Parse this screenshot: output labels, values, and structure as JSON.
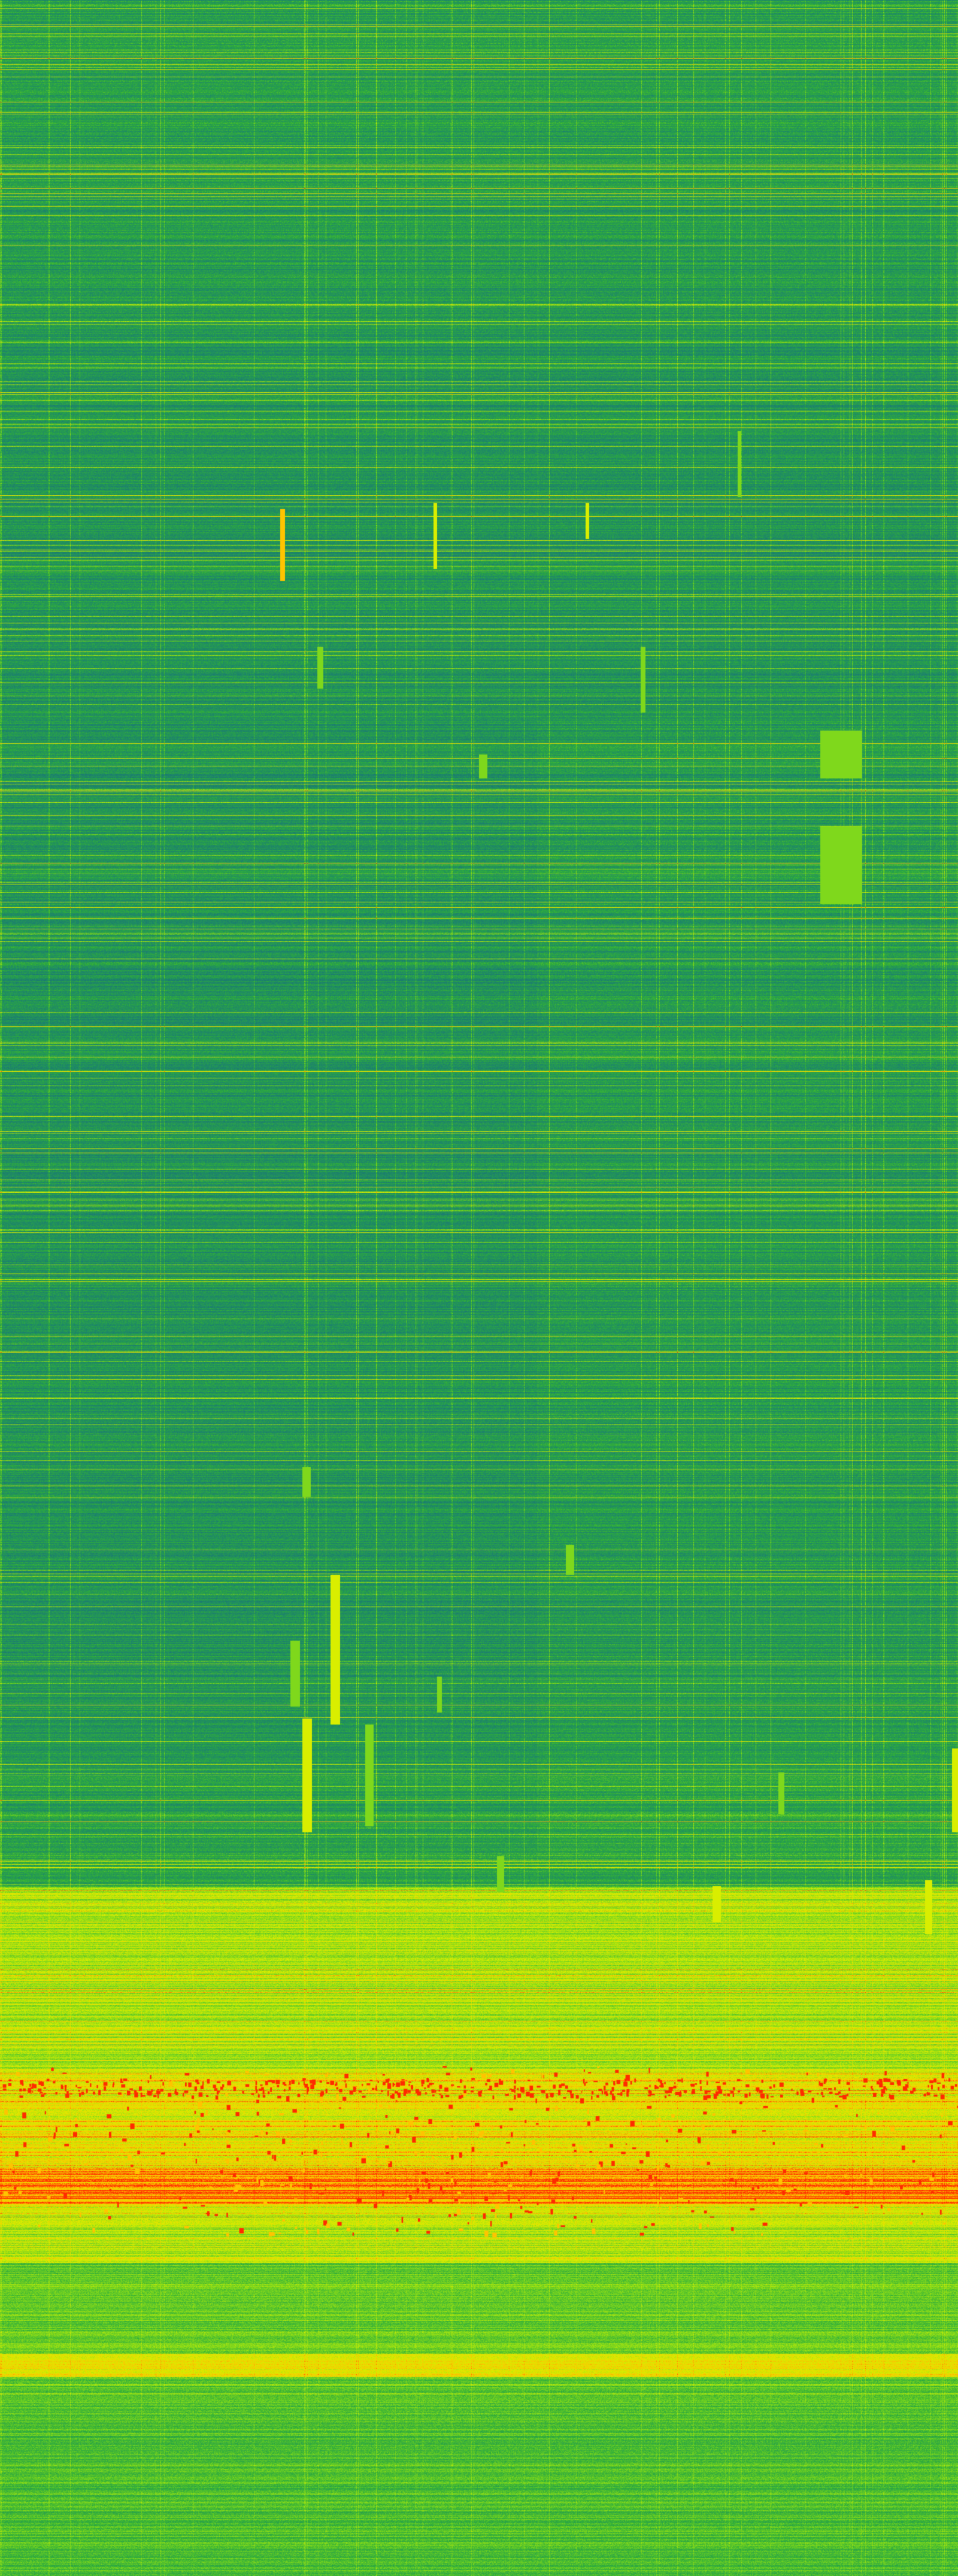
{
  "image": {
    "kind": "spectrogram",
    "colormap": [
      "#1a6e7a",
      "#1e8a66",
      "#2fae3a",
      "#7fd81c",
      "#d9ee00",
      "#ffc400",
      "#ff2a00"
    ],
    "background": "#1a6e7a"
  }
}
